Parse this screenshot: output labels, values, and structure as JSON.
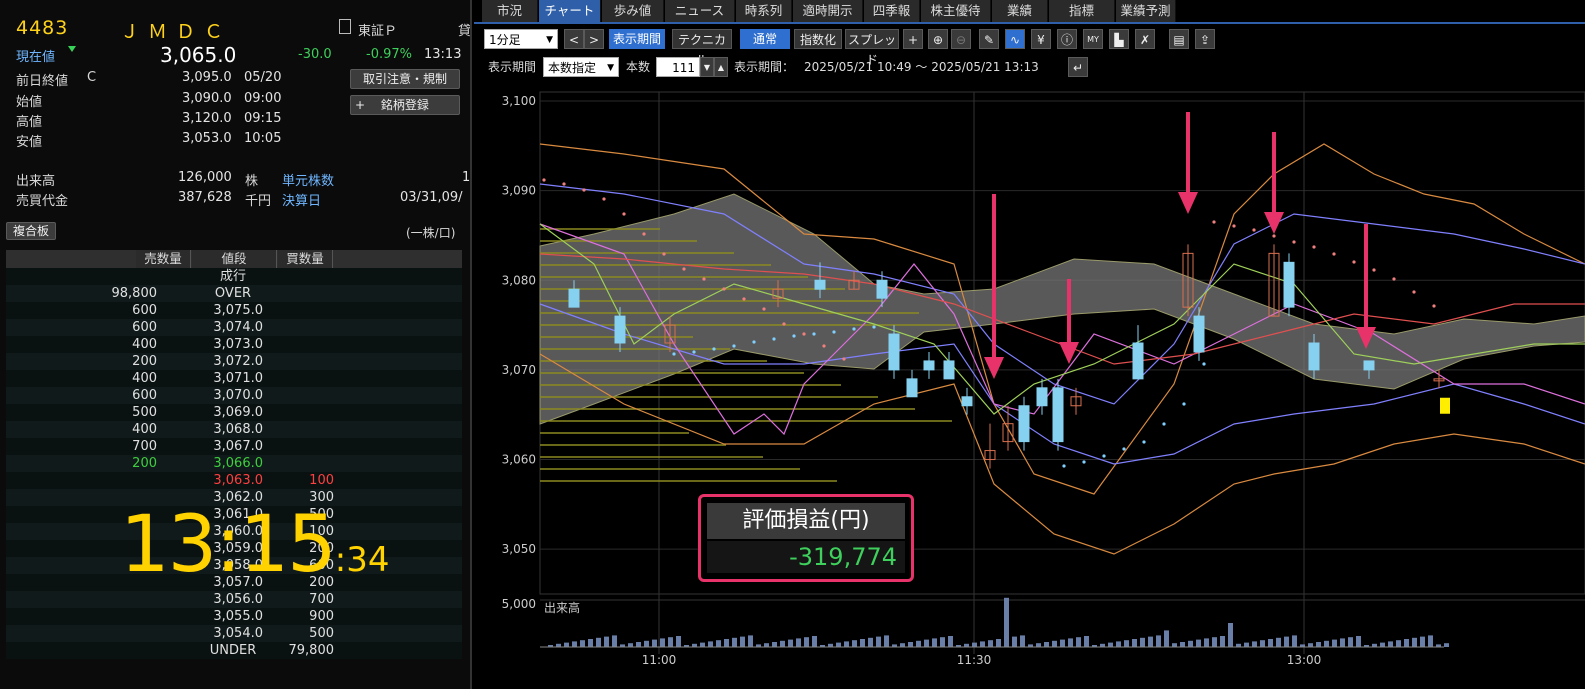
{
  "stock": {
    "code": "4483",
    "name": "ＪＭＤＣ",
    "market": "東証Ｐ",
    "market_suffix": "貸",
    "current_label": "現在値",
    "current_price": "3,065.0",
    "change": "-30.0",
    "change_pct": "-0.97%",
    "time": "13:13",
    "prev_close_label": "前日終値",
    "prev_close_flag": "C",
    "prev_close": "3,095.0",
    "prev_close_date": "05/20",
    "open_label": "始値",
    "open": "3,090.0",
    "open_time": "09:00",
    "high_label": "高値",
    "high": "3,120.0",
    "high_time": "09:15",
    "low_label": "安値",
    "low": "3,053.0",
    "low_time": "10:05",
    "volume_label": "出来高",
    "volume": "126,000",
    "volume_unit": "株",
    "unit_label": "単元株数",
    "unit_value": "1",
    "turnover_label": "売買代金",
    "turnover": "387,628",
    "turnover_unit": "千円",
    "settle_label": "決算日",
    "settle_value": "03/31,09/",
    "btn_notice": "取引注意・規制",
    "btn_register": "銘柄登録",
    "btn_register_plus": "+"
  },
  "board": {
    "tab_label": "複合板",
    "unit_note": "(一株/口)",
    "headers": [
      "売数量",
      "値段",
      "買数量"
    ],
    "rows": [
      {
        "sell": "",
        "price": "成行",
        "buy": "",
        "c": "#e0e0e0"
      },
      {
        "sell": "98,800",
        "price": "OVER",
        "buy": "",
        "c": "#e0e0e0"
      },
      {
        "sell": "600",
        "price": "3,075.0",
        "buy": "",
        "c": "#e0e0e0"
      },
      {
        "sell": "600",
        "price": "3,074.0",
        "buy": "",
        "c": "#e0e0e0"
      },
      {
        "sell": "400",
        "price": "3,073.0",
        "buy": "",
        "c": "#e0e0e0"
      },
      {
        "sell": "200",
        "price": "3,072.0",
        "buy": "",
        "c": "#e0e0e0"
      },
      {
        "sell": "400",
        "price": "3,071.0",
        "buy": "",
        "c": "#e0e0e0"
      },
      {
        "sell": "600",
        "price": "3,070.0",
        "buy": "",
        "c": "#e0e0e0"
      },
      {
        "sell": "500",
        "price": "3,069.0",
        "buy": "",
        "c": "#e0e0e0"
      },
      {
        "sell": "400",
        "price": "3,068.0",
        "buy": "",
        "c": "#e0e0e0"
      },
      {
        "sell": "700",
        "price": "3,067.0",
        "buy": "",
        "c": "#e0e0e0"
      },
      {
        "sell": "200",
        "price": "3,066.0",
        "buy": "",
        "c": "#3ecf3e"
      },
      {
        "sell": "",
        "price": "3,063.0",
        "buy": "100",
        "c": "#ff4040"
      },
      {
        "sell": "",
        "price": "3,062.0",
        "buy": "300",
        "c": "#e0e0e0"
      },
      {
        "sell": "",
        "price": "3,061.0",
        "buy": "500",
        "c": "#e0e0e0"
      },
      {
        "sell": "",
        "price": "3,060.0",
        "buy": "100",
        "c": "#e0e0e0"
      },
      {
        "sell": "",
        "price": "3,059.0",
        "buy": "200",
        "c": "#e0e0e0"
      },
      {
        "sell": "",
        "price": "3,058.0",
        "buy": "600",
        "c": "#e0e0e0"
      },
      {
        "sell": "",
        "price": "3,057.0",
        "buy": "200",
        "c": "#e0e0e0"
      },
      {
        "sell": "",
        "price": "3,056.0",
        "buy": "700",
        "c": "#e0e0e0"
      },
      {
        "sell": "",
        "price": "3,055.0",
        "buy": "900",
        "c": "#e0e0e0"
      },
      {
        "sell": "",
        "price": "3,054.0",
        "buy": "500",
        "c": "#e0e0e0"
      },
      {
        "sell": "",
        "price": "UNDER",
        "buy": "79,800",
        "c": "#e0e0e0"
      }
    ]
  },
  "clock": {
    "hm": "13:15",
    "sec": ":34"
  },
  "tabs": [
    "市況",
    "チャート",
    "歩み値",
    "ニュース",
    "時系列",
    "適時開示",
    "四季報",
    "株主優待",
    "業績",
    "指標",
    "業績予測"
  ],
  "toolbar": {
    "interval": "1分足",
    "display_period_btn": "表示期間",
    "technical_btn": "テクニカル",
    "normal_btn": "通常",
    "index_btn": "指数化",
    "spread_btn": "スプレッド",
    "period_label": "表示期間",
    "period_mode": "本数指定",
    "count_label": "本数",
    "count_value": "111",
    "range_label": "表示期間：",
    "range_value": "2025/05/21 10:49 〜 2025/05/21 13:13"
  },
  "chart_data": {
    "type": "candlestick",
    "ylim": [
      3045,
      3101
    ],
    "y_ticks": [
      "3,100",
      "3,090",
      "3,080",
      "3,070",
      "3,060",
      "3,050"
    ],
    "x_ticks": [
      "11:00",
      "11:30",
      "13:00"
    ],
    "volume_label": "出来高",
    "volume_tick": "5,000",
    "candles": [
      {
        "o": 3079,
        "h": 3080,
        "l": 3077,
        "c": 3077
      },
      {
        "o": 3076,
        "h": 3077,
        "l": 3072,
        "c": 3073
      },
      {
        "o": 3073,
        "h": 3076,
        "l": 3072,
        "c": 3075
      },
      {
        "o": 3078,
        "h": 3080,
        "l": 3077,
        "c": 3079
      },
      {
        "o": 3080,
        "h": 3082,
        "l": 3078,
        "c": 3079
      },
      {
        "o": 3079,
        "h": 3081,
        "l": 3079,
        "c": 3080
      },
      {
        "o": 3080,
        "h": 3081,
        "l": 3077,
        "c": 3078
      },
      {
        "o": 3074,
        "h": 3075,
        "l": 3069,
        "c": 3070
      },
      {
        "o": 3069,
        "h": 3070,
        "l": 3067,
        "c": 3067
      },
      {
        "o": 3071,
        "h": 3072,
        "l": 3069,
        "c": 3070
      },
      {
        "o": 3071,
        "h": 3072,
        "l": 3069,
        "c": 3069
      },
      {
        "o": 3067,
        "h": 3068,
        "l": 3065,
        "c": 3066
      },
      {
        "o": 3060,
        "h": 3064,
        "l": 3059,
        "c": 3061
      },
      {
        "o": 3062,
        "h": 3066,
        "l": 3061,
        "c": 3064
      },
      {
        "o": 3066,
        "h": 3067,
        "l": 3061,
        "c": 3062
      },
      {
        "o": 3068,
        "h": 3069,
        "l": 3065,
        "c": 3066
      },
      {
        "o": 3068,
        "h": 3069,
        "l": 3061,
        "c": 3062
      },
      {
        "o": 3066,
        "h": 3068,
        "l": 3065,
        "c": 3067
      },
      {
        "o": 3073,
        "h": 3075,
        "l": 3072,
        "c": 3069
      },
      {
        "o": 3077,
        "h": 3084,
        "l": 3076,
        "c": 3083
      },
      {
        "o": 3076,
        "h": 3077,
        "l": 3071,
        "c": 3072
      },
      {
        "o": 3076,
        "h": 3084,
        "l": 3076,
        "c": 3083
      },
      {
        "o": 3082,
        "h": 3083,
        "l": 3076,
        "c": 3077
      },
      {
        "o": 3073,
        "h": 3074,
        "l": 3069,
        "c": 3070
      },
      {
        "o": 3071,
        "h": 3071,
        "l": 3069,
        "c": 3070
      },
      {
        "o": 3069,
        "h": 3070,
        "l": 3068,
        "c": 3069
      }
    ],
    "last_marker_price": 3066,
    "pl_label": "評価損益(円)",
    "pl_value": "-319,774"
  },
  "colors": {
    "up": "#d97050",
    "down": "#86d0f0",
    "accent": "#2e5fa8",
    "arrow": "#e8336a"
  }
}
